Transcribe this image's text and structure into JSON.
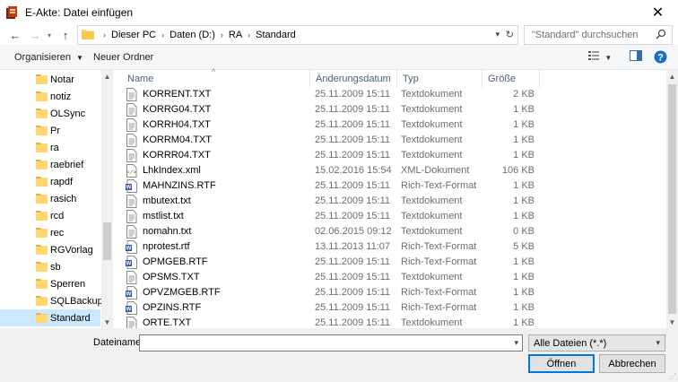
{
  "window": {
    "title": "E-Akte: Datei einfügen"
  },
  "address": {
    "breadcrumbs": [
      "Dieser PC",
      "Daten (D:)",
      "RA",
      "Standard"
    ],
    "search_placeholder": "\"Standard\" durchsuchen"
  },
  "toolbar": {
    "organize_label": "Organisieren",
    "new_folder_label": "Neuer Ordner"
  },
  "columns": {
    "name": "Name",
    "date": "Änderungsdatum",
    "type": "Typ",
    "size": "Größe"
  },
  "nav_items": [
    {
      "label": "Notar"
    },
    {
      "label": "notiz"
    },
    {
      "label": "OLSync"
    },
    {
      "label": "Pr"
    },
    {
      "label": "ra"
    },
    {
      "label": "raebrief"
    },
    {
      "label": "rapdf"
    },
    {
      "label": "rasich"
    },
    {
      "label": "rcd"
    },
    {
      "label": "rec"
    },
    {
      "label": "RGVorlag"
    },
    {
      "label": "sb"
    },
    {
      "label": "Sperren"
    },
    {
      "label": "SQLBackup"
    },
    {
      "label": "Standard",
      "selected": true
    }
  ],
  "files": [
    {
      "name": "KORRENT.TXT",
      "date": "25.11.2009 15:11",
      "type": "Textdokument",
      "size": "2 KB",
      "icon": "text-file-icon"
    },
    {
      "name": "KORRG04.TXT",
      "date": "25.11.2009 15:11",
      "type": "Textdokument",
      "size": "1 KB",
      "icon": "text-file-icon"
    },
    {
      "name": "KORRH04.TXT",
      "date": "25.11.2009 15:11",
      "type": "Textdokument",
      "size": "1 KB",
      "icon": "text-file-icon"
    },
    {
      "name": "KORRM04.TXT",
      "date": "25.11.2009 15:11",
      "type": "Textdokument",
      "size": "1 KB",
      "icon": "text-file-icon"
    },
    {
      "name": "KORRR04.TXT",
      "date": "25.11.2009 15:11",
      "type": "Textdokument",
      "size": "1 KB",
      "icon": "text-file-icon"
    },
    {
      "name": "LhkIndex.xml",
      "date": "15.02.2016 15:54",
      "type": "XML-Dokument",
      "size": "106 KB",
      "icon": "xml-file-icon"
    },
    {
      "name": "MAHNZINS.RTF",
      "date": "25.11.2009 15:11",
      "type": "Rich-Text-Format",
      "size": "1 KB",
      "icon": "word-file-icon"
    },
    {
      "name": "mbutext.txt",
      "date": "25.11.2009 15:11",
      "type": "Textdokument",
      "size": "1 KB",
      "icon": "text-file-icon"
    },
    {
      "name": "mstlist.txt",
      "date": "25.11.2009 15:11",
      "type": "Textdokument",
      "size": "1 KB",
      "icon": "text-file-icon"
    },
    {
      "name": "nomahn.txt",
      "date": "02.06.2015 09:12",
      "type": "Textdokument",
      "size": "0 KB",
      "icon": "text-file-icon"
    },
    {
      "name": "nprotest.rtf",
      "date": "13.11.2013 11:07",
      "type": "Rich-Text-Format",
      "size": "5 KB",
      "icon": "word-file-icon"
    },
    {
      "name": "OPMGEB.RTF",
      "date": "25.11.2009 15:11",
      "type": "Rich-Text-Format",
      "size": "1 KB",
      "icon": "word-file-icon"
    },
    {
      "name": "OPSMS.TXT",
      "date": "25.11.2009 15:11",
      "type": "Textdokument",
      "size": "1 KB",
      "icon": "text-file-icon"
    },
    {
      "name": "OPVZMGEB.RTF",
      "date": "25.11.2009 15:11",
      "type": "Rich-Text-Format",
      "size": "1 KB",
      "icon": "word-file-icon"
    },
    {
      "name": "OPZINS.RTF",
      "date": "25.11.2009 15:11",
      "type": "Rich-Text-Format",
      "size": "1 KB",
      "icon": "word-file-icon"
    },
    {
      "name": "ORTE.TXT",
      "date": "25.11.2009 15:11",
      "type": "Textdokument",
      "size": "1 KB",
      "icon": "text-file-icon"
    }
  ],
  "filename": {
    "label": "Dateiname:",
    "value": ""
  },
  "filter": {
    "selected": "Alle Dateien (*.*)"
  },
  "buttons": {
    "open_label": "Öffnen",
    "cancel_label": "Abbrechen"
  },
  "colors": {
    "selection": "#cce8ff",
    "accent": "#0078d7",
    "folder": "#ffd76e"
  }
}
